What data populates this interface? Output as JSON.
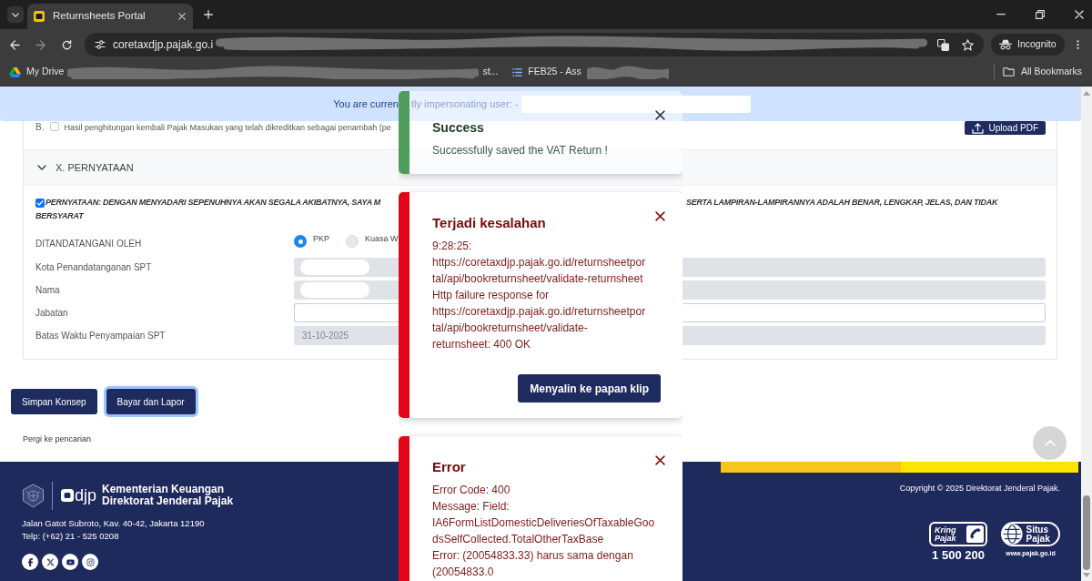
{
  "browser": {
    "tab": {
      "title": "Returnsheets Portal",
      "selected": true
    },
    "address": "coretaxdjp.pajak.go.i",
    "profile": "Incognito",
    "bookmarks": [
      {
        "label": "My Drive",
        "kind": "drive"
      },
      {
        "label": "st...",
        "kind": "plain"
      },
      {
        "label": "FEB25 - Ass",
        "kind": "list"
      }
    ],
    "all_bookmarks": "All Bookmarks"
  },
  "banner": {
    "parts": [
      "You are curren",
      "tly impersonating user: -"
    ]
  },
  "form": {
    "item_b": {
      "index": "B.",
      "checked": false,
      "text": "Hasil penghitungan kembali Pajak Masukan yang telah dikreditkan sebagai penambah (pe",
      "button": "Upload PDF"
    },
    "section": {
      "title": "X. PERNYATAAN",
      "expanded": true
    },
    "statement": {
      "checked": true,
      "parts": [
        "PERNYATAAN: DENGAN MENYADARI SEPENUHNYA AKAN SEGALA AKIBATNYA, SAYA M",
        "SERTA LAMPIRAN-LAMPIRANNYA ADALAH BENAR, LENGKAP, JELAS, DAN TIDAK",
        "BERSYARAT"
      ]
    },
    "signer": {
      "label": "DITANDATANGANI OLEH",
      "options": [
        {
          "label": "PKP",
          "selected": true
        },
        {
          "label": "Kuasa W",
          "selected": false
        }
      ]
    },
    "fields": [
      {
        "label": "Kota Penandatanganan SPT",
        "disabled": true,
        "redacted": true
      },
      {
        "label": "Nama",
        "disabled": true,
        "redacted": true
      },
      {
        "label": "Jabatan",
        "disabled": false
      },
      {
        "label": "Batas Waktu Penyampaian SPT",
        "disabled": true,
        "value": "31-10-2025"
      }
    ]
  },
  "actions": [
    {
      "label": "Simpan Konsep",
      "focused": false
    },
    {
      "label": "Bayar dan Lapor",
      "focused": true
    }
  ],
  "search_link": "Pergi ke pencarian",
  "footer": {
    "logo_text": "djp",
    "org_lines": [
      "Kementerian Keuangan",
      "Direktorat Jenderal Pajak"
    ],
    "contact_lines": [
      "Jalan Gatot Subroto, Kav. 40-42, Jakarta 12190",
      "Telp: (+62) 21 - 525 0208"
    ],
    "socials": [
      {
        "kind": "facebook"
      },
      {
        "kind": "x"
      },
      {
        "kind": "youtube"
      },
      {
        "kind": "instagram"
      }
    ],
    "copyright": "Copyright © 2025 Direktorat Jenderal Pajak.",
    "badges": [
      {
        "kind": "kring",
        "label": "Kring Pajak",
        "caption": "1 500 200"
      },
      {
        "kind": "situs",
        "label": "Situs Pajak",
        "caption": "www.pajak.go.id"
      }
    ]
  },
  "toasts": [
    {
      "kind": "success",
      "title": "Success",
      "message_lines": [
        "Successfully saved the VAT Return !"
      ]
    },
    {
      "kind": "error",
      "title": "Terjadi kesalahan",
      "message_lines": [
        "9:28:25:",
        "https://coretaxdjp.pajak.go.id/returnsheetpor",
        "tal/api/bookreturnsheet/validate-returnsheet",
        "Http failure response for",
        "https://coretaxdjp.pajak.go.id/returnsheetpor",
        "tal/api/bookreturnsheet/validate-",
        "returnsheet: 400 OK"
      ],
      "button": "Menyalin ke papan klip"
    },
    {
      "kind": "error",
      "title": "Error",
      "message_lines": [
        "Error Code: 400",
        "Message: Field:",
        "IA6FormListDomesticDeliveriesOfTaxableGoo",
        "dsSelfCollected.TotalOtherTaxBase",
        "Error: (20054833.33) harus sama dengan",
        "(20054833.0"
      ]
    }
  ]
}
